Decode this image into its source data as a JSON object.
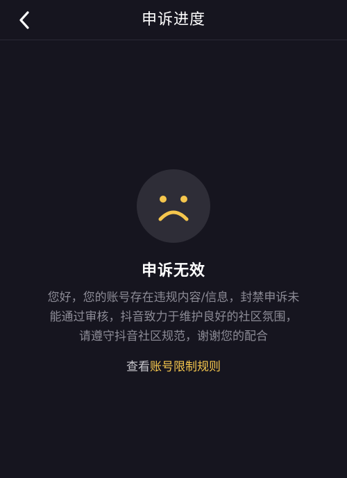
{
  "header": {
    "title": "申诉进度",
    "back_icon": "chevron-left-icon"
  },
  "status": {
    "icon": "sad-face-icon",
    "title": "申诉无效",
    "description_lines": [
      "您好，您的账号存在违规内容/信息，封禁申诉未",
      "能通过审核，抖音致力于维护良好的社区氛围，",
      "请遵守抖音社区规范，谢谢您的配合"
    ]
  },
  "rules": {
    "prefix": "查看",
    "link_label": "账号限制规则"
  },
  "colors": {
    "background": "#16151f",
    "accent": "#f5c64d",
    "face_background": "#2e2d37"
  }
}
